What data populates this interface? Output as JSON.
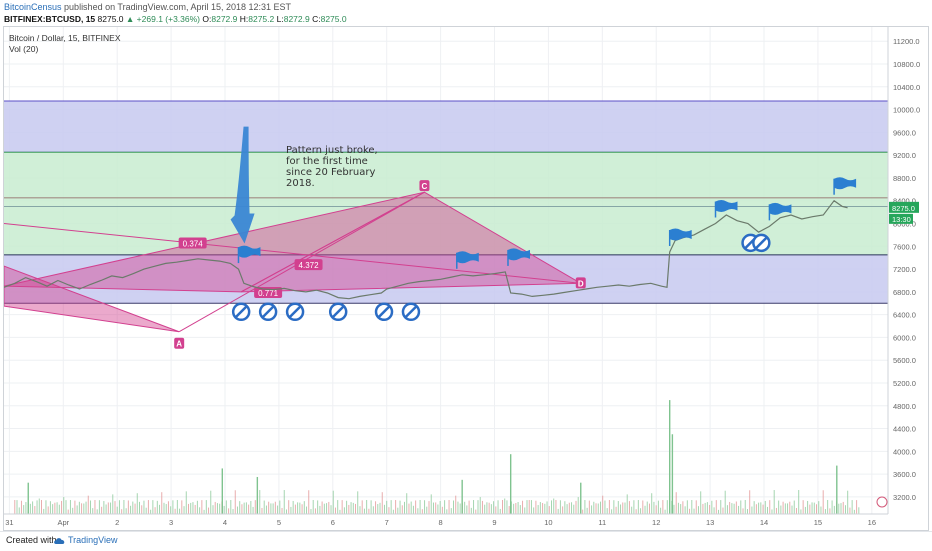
{
  "header": {
    "user": "BitcoinCensus",
    "published": "published on TradingView.com, April 15, 2018 12:31 EST",
    "symbol": "BITFINEX:BTCUSD, 15",
    "last": "8275.0",
    "change": "▲ +269.1 (+3.36%)",
    "o_label": "O:",
    "o_val": "8272.9",
    "h_label": "H:",
    "h_val": "8275.2",
    "l_label": "L:",
    "l_val": "8272.9",
    "c_label": "C:",
    "c_val": "8275.0"
  },
  "chart_info": {
    "title": "Bitcoin / Dollar, 15, BITFINEX",
    "indicator": "Vol (20)"
  },
  "annotation": {
    "text": "Pattern just broke, for the first time since 20 February 2018."
  },
  "footer": {
    "created_with": "Created with",
    "brand": "TradingView"
  },
  "chart_data": {
    "type": "line",
    "symbol": "BTCUSD",
    "interval": "15",
    "exchange": "BITFINEX",
    "x_tick_labels": [
      "31",
      "Apr",
      "2",
      "3",
      "4",
      "5",
      "6",
      "7",
      "8",
      "9",
      "10",
      "11",
      "12",
      "13",
      "14",
      "15",
      "16"
    ],
    "x_ticks": [
      0,
      1,
      2,
      3,
      4,
      5,
      6,
      7,
      8,
      9,
      10,
      11,
      12,
      13,
      14,
      15,
      16
    ],
    "y_tick_labels": [
      "11200.0",
      "10800.0",
      "10400.0",
      "10000.0",
      "9600.0",
      "9200.0",
      "8800.0",
      "8400.0",
      "8000.0",
      "7600.0",
      "7200.0",
      "6800.0",
      "6400.0",
      "6000.0",
      "5600.0",
      "5200.0",
      "4800.0",
      "4400.0",
      "4000.0",
      "3600.0",
      "3200.0"
    ],
    "y_ticks": [
      11200,
      10800,
      10400,
      10000,
      9600,
      9200,
      8800,
      8400,
      8000,
      7600,
      7200,
      6800,
      6400,
      6000,
      5600,
      5200,
      4800,
      4400,
      4000,
      3600,
      3200
    ],
    "ylim": [
      2900,
      11450
    ],
    "xlim": [
      -0.1,
      16.3
    ],
    "last_price_label": "8275.0",
    "countdown_label": "13:30",
    "price_series": [
      [
        -0.1,
        6880
      ],
      [
        0.1,
        6950
      ],
      [
        0.3,
        7050
      ],
      [
        0.5,
        6980
      ],
      [
        0.7,
        6900
      ],
      [
        0.9,
        7000
      ],
      [
        1.1,
        6920
      ],
      [
        1.3,
        6850
      ],
      [
        1.5,
        6930
      ],
      [
        1.7,
        7000
      ],
      [
        1.9,
        7080
      ],
      [
        2.1,
        7050
      ],
      [
        2.3,
        7120
      ],
      [
        2.5,
        7200
      ],
      [
        2.7,
        7250
      ],
      [
        2.9,
        7300
      ],
      [
        3.1,
        7320
      ],
      [
        3.3,
        7350
      ],
      [
        3.5,
        7380
      ],
      [
        3.7,
        7360
      ],
      [
        3.9,
        7340
      ],
      [
        4.1,
        7300
      ],
      [
        4.25,
        7200
      ],
      [
        4.35,
        6950
      ],
      [
        4.5,
        6900
      ],
      [
        4.7,
        6850
      ],
      [
        4.9,
        6840
      ],
      [
        5.1,
        6860
      ],
      [
        5.3,
        6820
      ],
      [
        5.5,
        6800
      ],
      [
        5.7,
        6830
      ],
      [
        5.9,
        6780
      ],
      [
        6.1,
        6700
      ],
      [
        6.3,
        6680
      ],
      [
        6.5,
        6720
      ],
      [
        6.7,
        6750
      ],
      [
        6.9,
        6780
      ],
      [
        7.0,
        6850
      ],
      [
        7.2,
        6900
      ],
      [
        7.4,
        6950
      ],
      [
        7.6,
        6980
      ],
      [
        7.8,
        7000
      ],
      [
        8.0,
        7020
      ],
      [
        8.2,
        7060
      ],
      [
        8.4,
        7100
      ],
      [
        8.6,
        7080
      ],
      [
        8.8,
        7100
      ],
      [
        9.0,
        7120
      ],
      [
        9.2,
        7150
      ],
      [
        9.3,
        6780
      ],
      [
        9.5,
        6760
      ],
      [
        9.7,
        6720
      ],
      [
        9.9,
        6740
      ],
      [
        10.1,
        6760
      ],
      [
        10.3,
        6790
      ],
      [
        10.5,
        6820
      ],
      [
        10.7,
        6850
      ],
      [
        10.9,
        6880
      ],
      [
        11.1,
        6900
      ],
      [
        11.3,
        6920
      ],
      [
        11.5,
        6900
      ],
      [
        11.7,
        6930
      ],
      [
        11.9,
        6950
      ],
      [
        12.1,
        6900
      ],
      [
        12.2,
        6880
      ],
      [
        12.25,
        7500
      ],
      [
        12.35,
        7700
      ],
      [
        12.5,
        7750
      ],
      [
        12.7,
        7800
      ],
      [
        12.9,
        7900
      ],
      [
        13.1,
        8000
      ],
      [
        13.3,
        8150
      ],
      [
        13.5,
        8050
      ],
      [
        13.7,
        8000
      ],
      [
        13.9,
        7850
      ],
      [
        14.1,
        7950
      ],
      [
        14.3,
        8100
      ],
      [
        14.5,
        8150
      ],
      [
        14.7,
        8080
      ],
      [
        14.9,
        8120
      ],
      [
        15.1,
        8150
      ],
      [
        15.3,
        8400
      ],
      [
        15.45,
        8300
      ],
      [
        15.55,
        8275
      ]
    ],
    "bands": [
      {
        "name": "upper",
        "from": 9250,
        "to": 10150,
        "fill": "#c7c9f0",
        "border": "#5b4fc7"
      },
      {
        "name": "middle",
        "from": 7450,
        "to": 9250,
        "fill": "#c8ecd0",
        "border": "#3f9e5a"
      },
      {
        "name": "lower",
        "from": 6600,
        "to": 7450,
        "fill": "#c7c9f0",
        "border": "#3a3a6a"
      }
    ],
    "harmonic_pattern": {
      "points": [
        {
          "label": "",
          "x": -0.1,
          "y": 6550
        },
        {
          "label": "A",
          "x": 3.15,
          "y": 6100
        },
        {
          "label": "C",
          "x": 7.7,
          "y": 8550
        },
        {
          "label": "D",
          "x": 10.6,
          "y": 6950
        }
      ],
      "ratios": [
        {
          "label": "0.374",
          "x": 3.4,
          "y": 7650
        },
        {
          "label": "4.372",
          "x": 5.55,
          "y": 7270
        },
        {
          "label": "0.771",
          "x": 4.8,
          "y": 6780
        }
      ],
      "color": "#d2408f"
    },
    "flags_x": [
      4.25,
      8.3,
      9.25,
      12.25,
      13.1,
      14.1,
      15.3
    ],
    "no_entry_x": [
      4.3,
      4.8,
      5.3,
      6.1,
      6.95,
      7.45
    ],
    "no_entry_x_right": [
      13.75,
      13.95
    ],
    "volume_spikes": [
      {
        "x": 12.25,
        "h": 4900
      },
      {
        "x": 12.3,
        "h": 4300
      },
      {
        "x": 9.3,
        "h": 3950
      },
      {
        "x": 15.35,
        "h": 3750
      },
      {
        "x": 3.95,
        "h": 3700
      },
      {
        "x": 4.6,
        "h": 3550
      },
      {
        "x": 8.4,
        "h": 3500
      },
      {
        "x": 0.35,
        "h": 3450
      },
      {
        "x": 10.6,
        "h": 3450
      }
    ],
    "volume_base": 3050,
    "colors": {
      "price_line": "#6b7a6b",
      "pattern": "#d2408f",
      "flag": "#2b7fd1",
      "arrow": "#3a86d4",
      "no_entry": "#2b6cc4",
      "last_price": "#26a65b",
      "volume_up": "#7fc38f",
      "volume_down": "#e08a8a",
      "grid": "#eef0f3",
      "axis_text": "#666666"
    }
  }
}
